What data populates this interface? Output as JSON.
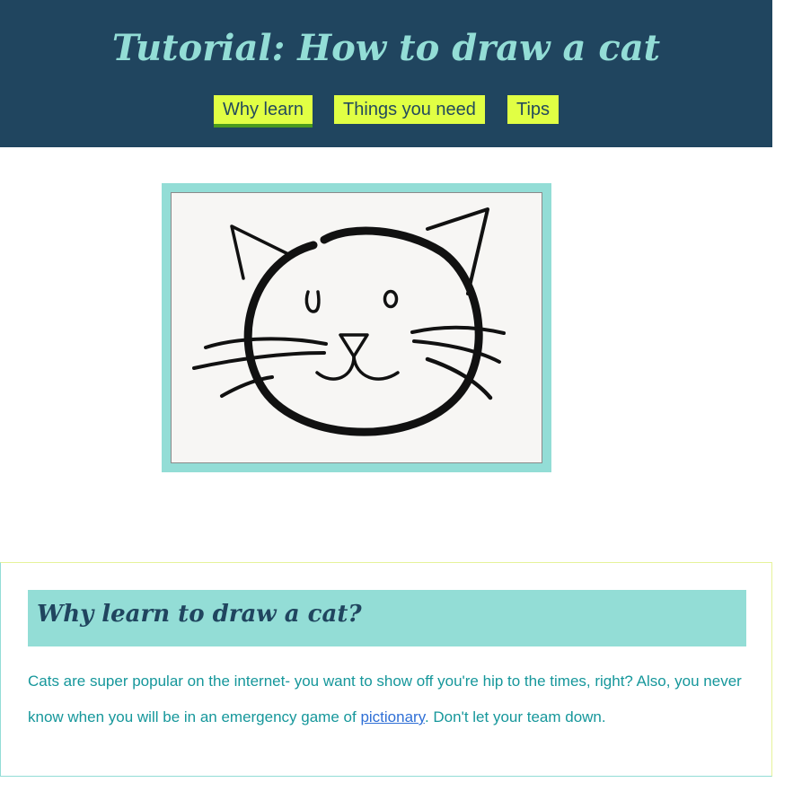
{
  "header": {
    "title": "Tutorial: How to draw a cat",
    "nav": [
      {
        "label": "Why learn",
        "active": true
      },
      {
        "label": "Things you need",
        "active": false
      },
      {
        "label": "Tips",
        "active": false
      }
    ]
  },
  "colors": {
    "header_bg": "#20455f",
    "accent_teal": "#93ddd6",
    "nav_bg": "#e1ff44",
    "body_text": "#16979b",
    "link": "#2f6fd6"
  },
  "section": {
    "heading": "Why learn to draw a cat?",
    "body_part1": "Cats are super popular on the internet- you want to show off you're hip to the times, right? Also, you never know when you will be in an emergency game of ",
    "link_text": "pictionary",
    "body_part2": ". Don't let your team down."
  }
}
